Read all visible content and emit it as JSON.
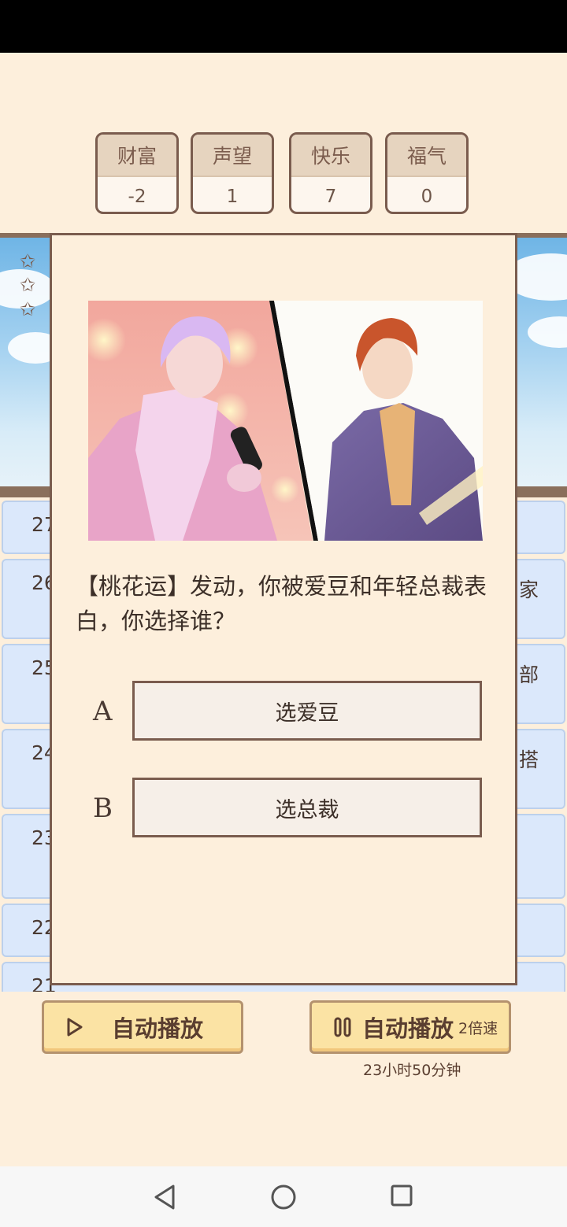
{
  "stats": [
    {
      "label": "财富",
      "value": "-2"
    },
    {
      "label": "声望",
      "value": "1"
    },
    {
      "label": "快乐",
      "value": "7"
    },
    {
      "label": "福气",
      "value": "0"
    }
  ],
  "history": {
    "rows": [
      {
        "num": "27",
        "tail": ""
      },
      {
        "num": "26",
        "tail": "家"
      },
      {
        "num": "25",
        "tail": "部"
      },
      {
        "num": "24",
        "tail": "搭"
      },
      {
        "num": "23",
        "tail": ""
      },
      {
        "num": "22",
        "tail": ""
      },
      {
        "num": "21",
        "tail": ""
      }
    ]
  },
  "modal": {
    "question": "【桃花运】发动，你被爱豆和年轻总裁表白，你选择谁？",
    "options": [
      {
        "letter": "A",
        "label": "选爱豆"
      },
      {
        "letter": "B",
        "label": "选总裁"
      }
    ]
  },
  "controls": {
    "autoplay_label": "自动播放",
    "autoplay_fast_label": "自动播放",
    "speed_label": "2倍速",
    "timer": "23小时50分钟"
  },
  "icons": {
    "play": "play-icon",
    "pause": "pause-icon",
    "star": "star-icon"
  }
}
